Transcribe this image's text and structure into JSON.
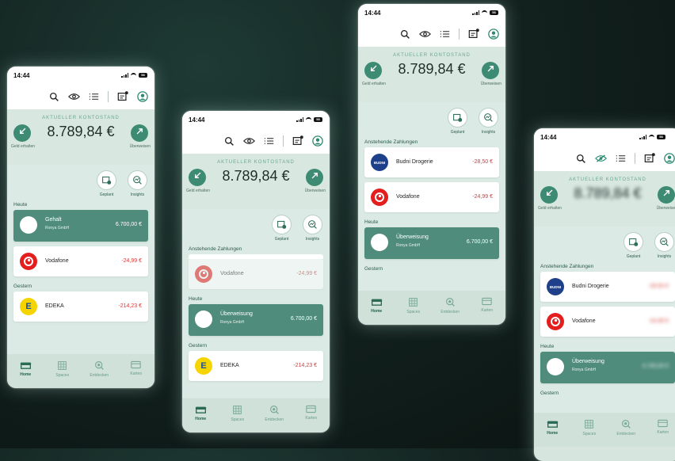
{
  "status": {
    "time": "14:44",
    "battery": "58"
  },
  "balance": {
    "label": "AKTUELLER KONTOSTAND",
    "amount": "8.789,84 €",
    "receive_label": "Geld erhalten",
    "transfer_label": "Überweisen"
  },
  "quick_actions": {
    "planned": "Geplant",
    "insights": "Insights"
  },
  "sections": {
    "today": "Heute",
    "yesterday": "Gestern",
    "pending": "Anstehende Zahlungen"
  },
  "transactions": {
    "gehalt": {
      "name": "Gehalt",
      "sub": "Ronya GmbH",
      "amount": "6.700,00 €"
    },
    "ueberweisung": {
      "name": "Überweisung",
      "sub": "Ronya GmbH",
      "amount": "6.700,00 €"
    },
    "vodafone": {
      "name": "Vodafone",
      "amount": "-24,99 €"
    },
    "edeka": {
      "name": "EDEKA",
      "amount": "-214,23 €"
    },
    "budni": {
      "name": "Budni Drogerie",
      "amount": "-28,50 €",
      "logo_text": "BUDNI"
    },
    "edeka_logo": "E"
  },
  "tabs": {
    "home": "Home",
    "spaces": "Spaces",
    "entdecken": "Entdecken",
    "karten": "Karten"
  },
  "colors": {
    "accent": "#3e8b74",
    "green_card": "#4f8c7b",
    "negative": "#d43a3a",
    "background": "#13221f"
  },
  "icons": [
    "search-icon",
    "eye-icon",
    "eye-off-icon",
    "list-icon",
    "messages-icon",
    "profile-icon",
    "arrow-down-left-icon",
    "arrow-up-right-icon",
    "calendar-clock-icon",
    "insights-icon",
    "home-icon",
    "spaces-icon",
    "discover-icon",
    "card-icon"
  ]
}
